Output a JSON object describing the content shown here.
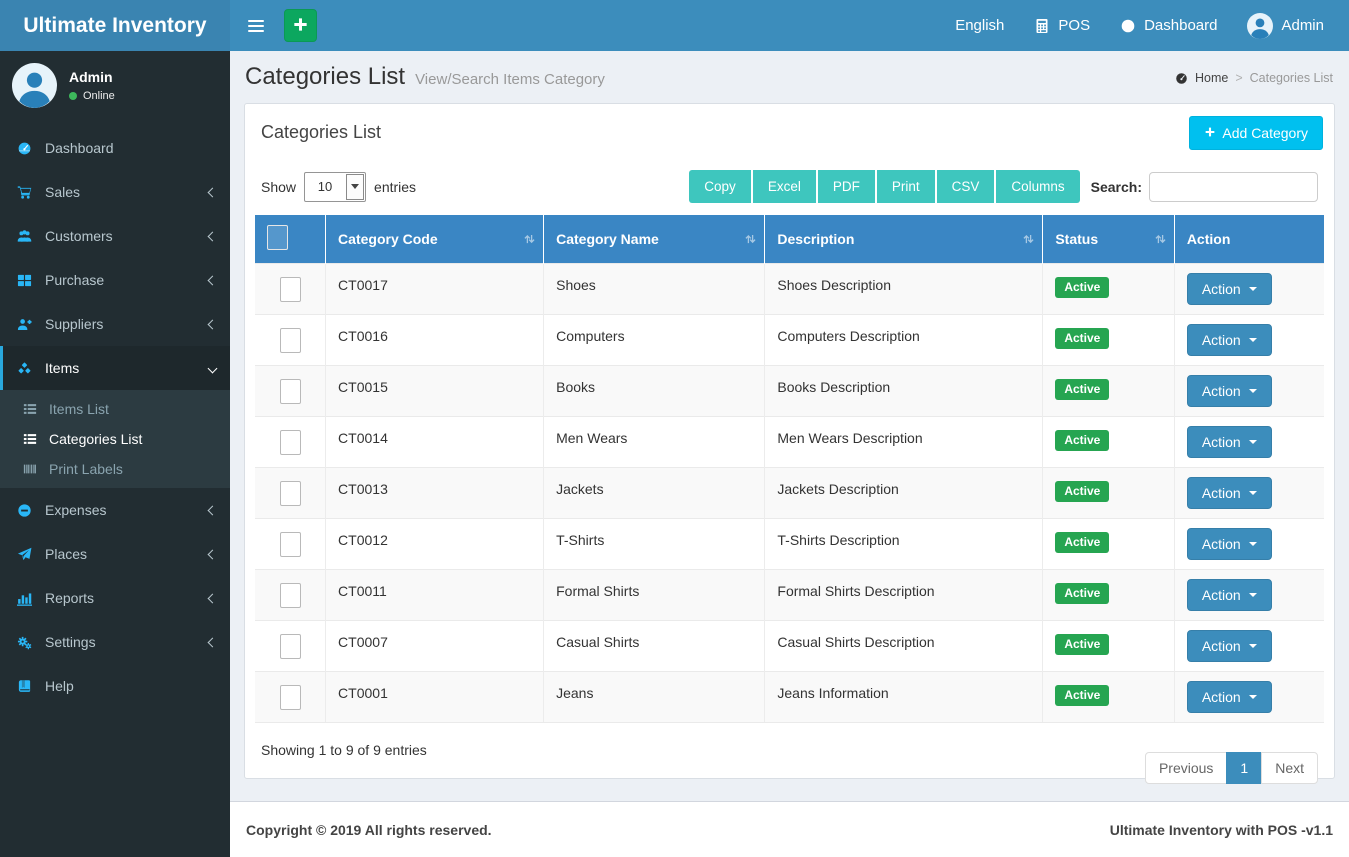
{
  "brand": "Ultimate Inventory",
  "navbar": {
    "language": "English",
    "pos": "POS",
    "dashboard": "Dashboard",
    "user": "Admin"
  },
  "user_panel": {
    "name": "Admin",
    "status": "Online"
  },
  "sidebar": {
    "items": [
      {
        "label": "Dashboard",
        "icon": "dashboard",
        "chevron": null
      },
      {
        "label": "Sales",
        "icon": "cart",
        "chevron": "left"
      },
      {
        "label": "Customers",
        "icon": "users",
        "chevron": "left"
      },
      {
        "label": "Purchase",
        "icon": "grid",
        "chevron": "left"
      },
      {
        "label": "Suppliers",
        "icon": "user-plus",
        "chevron": "left"
      },
      {
        "label": "Items",
        "icon": "cubes",
        "chevron": "down",
        "active": true,
        "submenu": [
          {
            "label": "Items List",
            "icon": "list"
          },
          {
            "label": "Categories List",
            "icon": "list",
            "active": true
          },
          {
            "label": "Print Labels",
            "icon": "barcode"
          }
        ]
      },
      {
        "label": "Expenses",
        "icon": "minus-circle",
        "chevron": "left"
      },
      {
        "label": "Places",
        "icon": "paper-plane",
        "chevron": "left"
      },
      {
        "label": "Reports",
        "icon": "bar-chart",
        "chevron": "left"
      },
      {
        "label": "Settings",
        "icon": "cogs",
        "chevron": "left"
      },
      {
        "label": "Help",
        "icon": "book",
        "chevron": null
      }
    ]
  },
  "page": {
    "title": "Categories List",
    "subtitle": "View/Search Items Category",
    "breadcrumb": {
      "home": "Home",
      "current": "Categories List"
    }
  },
  "card": {
    "title": "Categories List",
    "add_button": "Add Category"
  },
  "table_controls": {
    "show_label": "Show",
    "page_length": "10",
    "entries_label": "entries",
    "buttons": [
      "Copy",
      "Excel",
      "PDF",
      "Print",
      "CSV",
      "Columns"
    ],
    "search_label": "Search:",
    "search_value": ""
  },
  "table": {
    "columns": [
      {
        "label": "Category Code",
        "sortable": true
      },
      {
        "label": "Category Name",
        "sortable": true
      },
      {
        "label": "Description",
        "sortable": true
      },
      {
        "label": "Status",
        "sortable": true
      },
      {
        "label": "Action",
        "sortable": false
      }
    ],
    "rows": [
      {
        "code": "CT0017",
        "name": "Shoes",
        "description": "Shoes Description",
        "status": "Active",
        "action_label": "Action"
      },
      {
        "code": "CT0016",
        "name": "Computers",
        "description": "Computers Description",
        "status": "Active",
        "action_label": "Action"
      },
      {
        "code": "CT0015",
        "name": "Books",
        "description": "Books Description",
        "status": "Active",
        "action_label": "Action"
      },
      {
        "code": "CT0014",
        "name": "Men Wears",
        "description": "Men Wears Description",
        "status": "Active",
        "action_label": "Action"
      },
      {
        "code": "CT0013",
        "name": "Jackets",
        "description": "Jackets Description",
        "status": "Active",
        "action_label": "Action"
      },
      {
        "code": "CT0012",
        "name": "T-Shirts",
        "description": "T-Shirts Description",
        "status": "Active",
        "action_label": "Action"
      },
      {
        "code": "CT0011",
        "name": "Formal Shirts",
        "description": "Formal Shirts Description",
        "status": "Active",
        "action_label": "Action"
      },
      {
        "code": "CT0007",
        "name": "Casual Shirts",
        "description": "Casual Shirts Description",
        "status": "Active",
        "action_label": "Action"
      },
      {
        "code": "CT0001",
        "name": "Jeans",
        "description": "Jeans Information",
        "status": "Active",
        "action_label": "Action"
      }
    ]
  },
  "table_footer": {
    "info": "Showing 1 to 9 of 9 entries",
    "pagination": {
      "previous": "Previous",
      "page": "1",
      "next": "Next"
    }
  },
  "footer": {
    "left": "Copyright © 2019 All rights reserved.",
    "right": "Ultimate Inventory with POS -v1.1"
  },
  "colors": {
    "navbar_blue": "#3c8dbc",
    "logo_blue": "#3a84b1",
    "sidebar_dark": "#222d32",
    "submenu_dark": "#2c3b41",
    "sidebar_icon_blue": "#29b6f6",
    "table_header_blue": "#3a86c4",
    "export_teal": "#3ec6be",
    "add_button_aqua": "#00c0ef",
    "quick_add_green": "#0ca75f",
    "status_green": "#26a551",
    "content_bg": "#ecf0f5"
  }
}
